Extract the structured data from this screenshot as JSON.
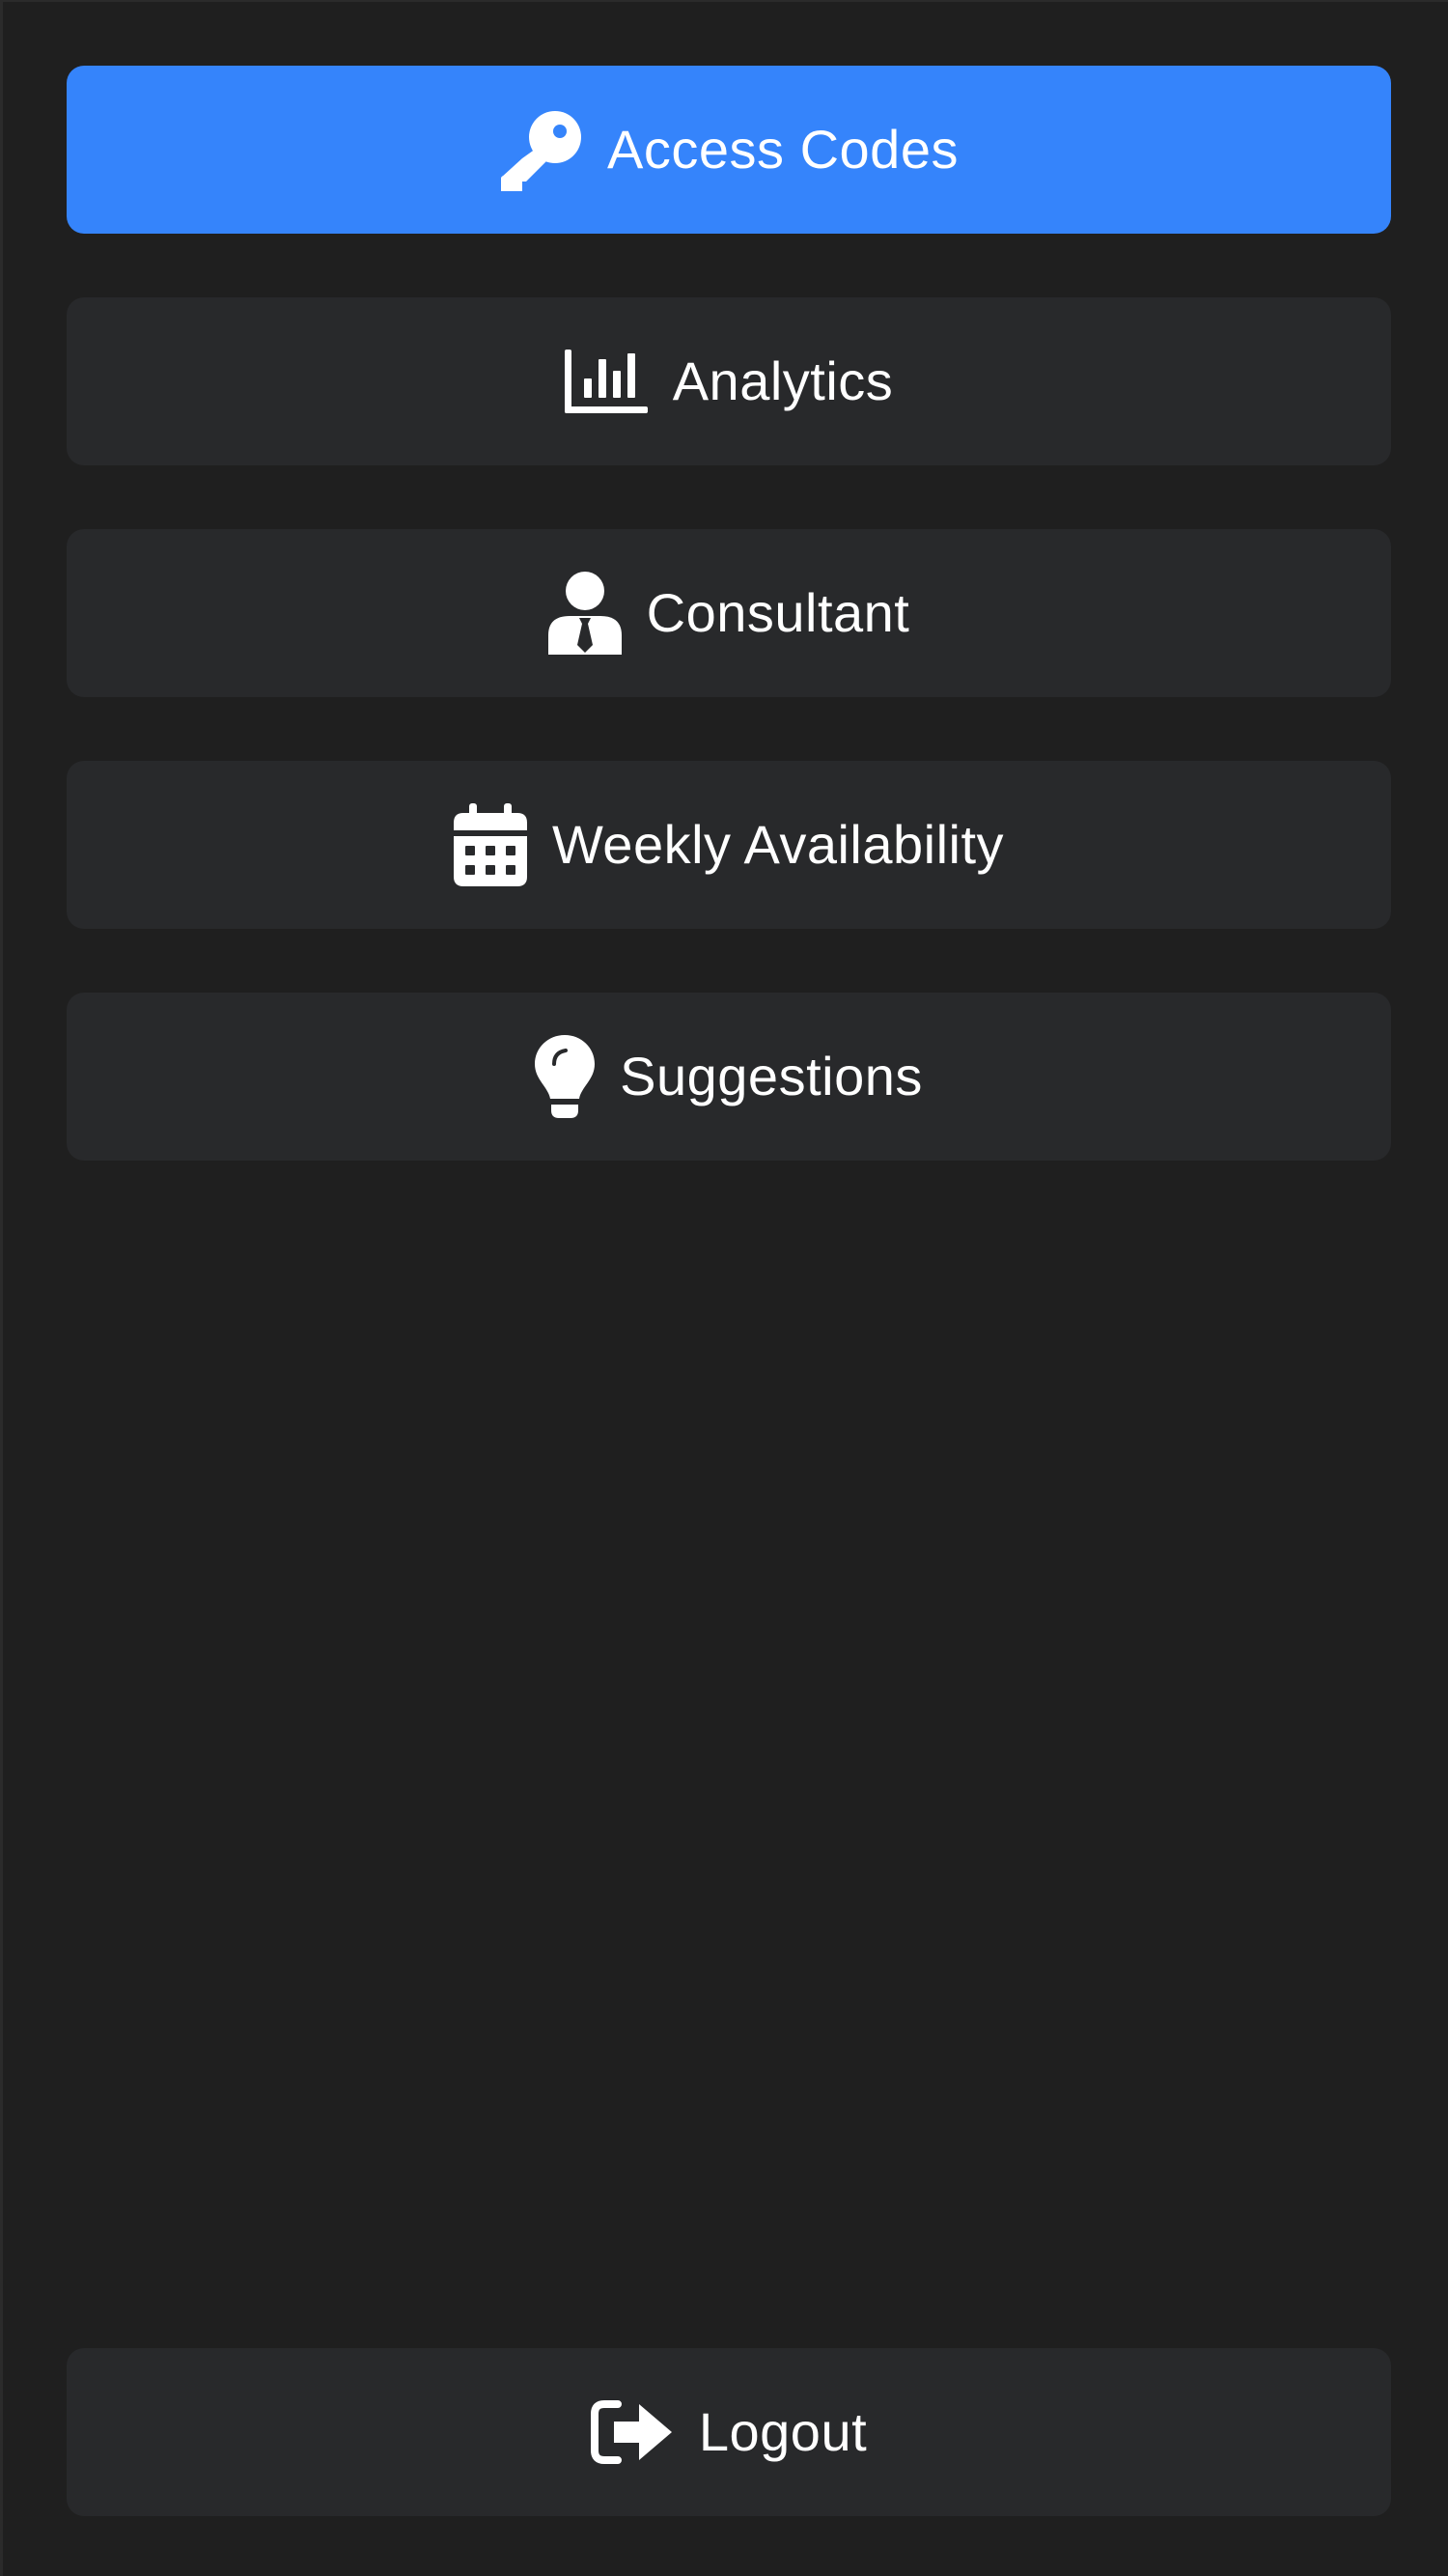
{
  "theme": {
    "background": "#1f1f1f",
    "item_background": "#28292b",
    "active_background": "#3584fb",
    "text_color": "#ffffff"
  },
  "nav": {
    "items": [
      {
        "label": "Access Codes",
        "icon": "key-icon",
        "active": true
      },
      {
        "label": "Analytics",
        "icon": "bar-chart-icon",
        "active": false
      },
      {
        "label": "Consultant",
        "icon": "user-tie-icon",
        "active": false
      },
      {
        "label": "Weekly Availability",
        "icon": "calendar-icon",
        "active": false
      },
      {
        "label": "Suggestions",
        "icon": "lightbulb-icon",
        "active": false
      }
    ]
  },
  "logout": {
    "label": "Logout",
    "icon": "logout-icon"
  }
}
